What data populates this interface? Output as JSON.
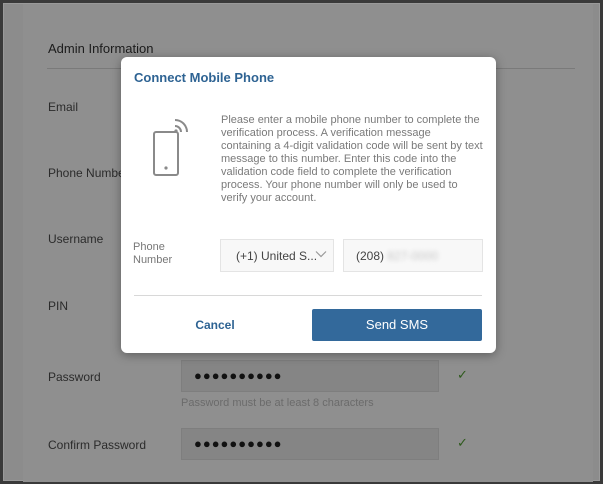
{
  "form": {
    "section_title": "Admin Information",
    "labels": {
      "email": "Email",
      "phone": "Phone Number",
      "username": "Username",
      "pin": "PIN",
      "password": "Password",
      "confirm_password": "Confirm Password"
    },
    "password_value": "●●●●●●●●●●",
    "confirm_password_value": "●●●●●●●●●●",
    "password_hint": "Password must be at least 8 characters",
    "valid_mark": "✓"
  },
  "modal": {
    "title": "Connect Mobile Phone",
    "icon": "mobile-phone-icon",
    "description": "Please enter a mobile phone number to complete the verification process. A verification message containing a 4-digit validation code will be sent by text message to this number. Enter this code into the validation code field to complete the verification process. Your phone number will only be used to verify your account.",
    "phone_label": "Phone Number",
    "country_value": "(+1) United S...",
    "phone_prefix": "(208)",
    "phone_rest": "827-0000",
    "cancel_label": "Cancel",
    "send_label": "Send SMS"
  },
  "colors": {
    "accent": "#2e6393",
    "primary_button": "#33699b",
    "overlay": "#8f8f8f"
  }
}
